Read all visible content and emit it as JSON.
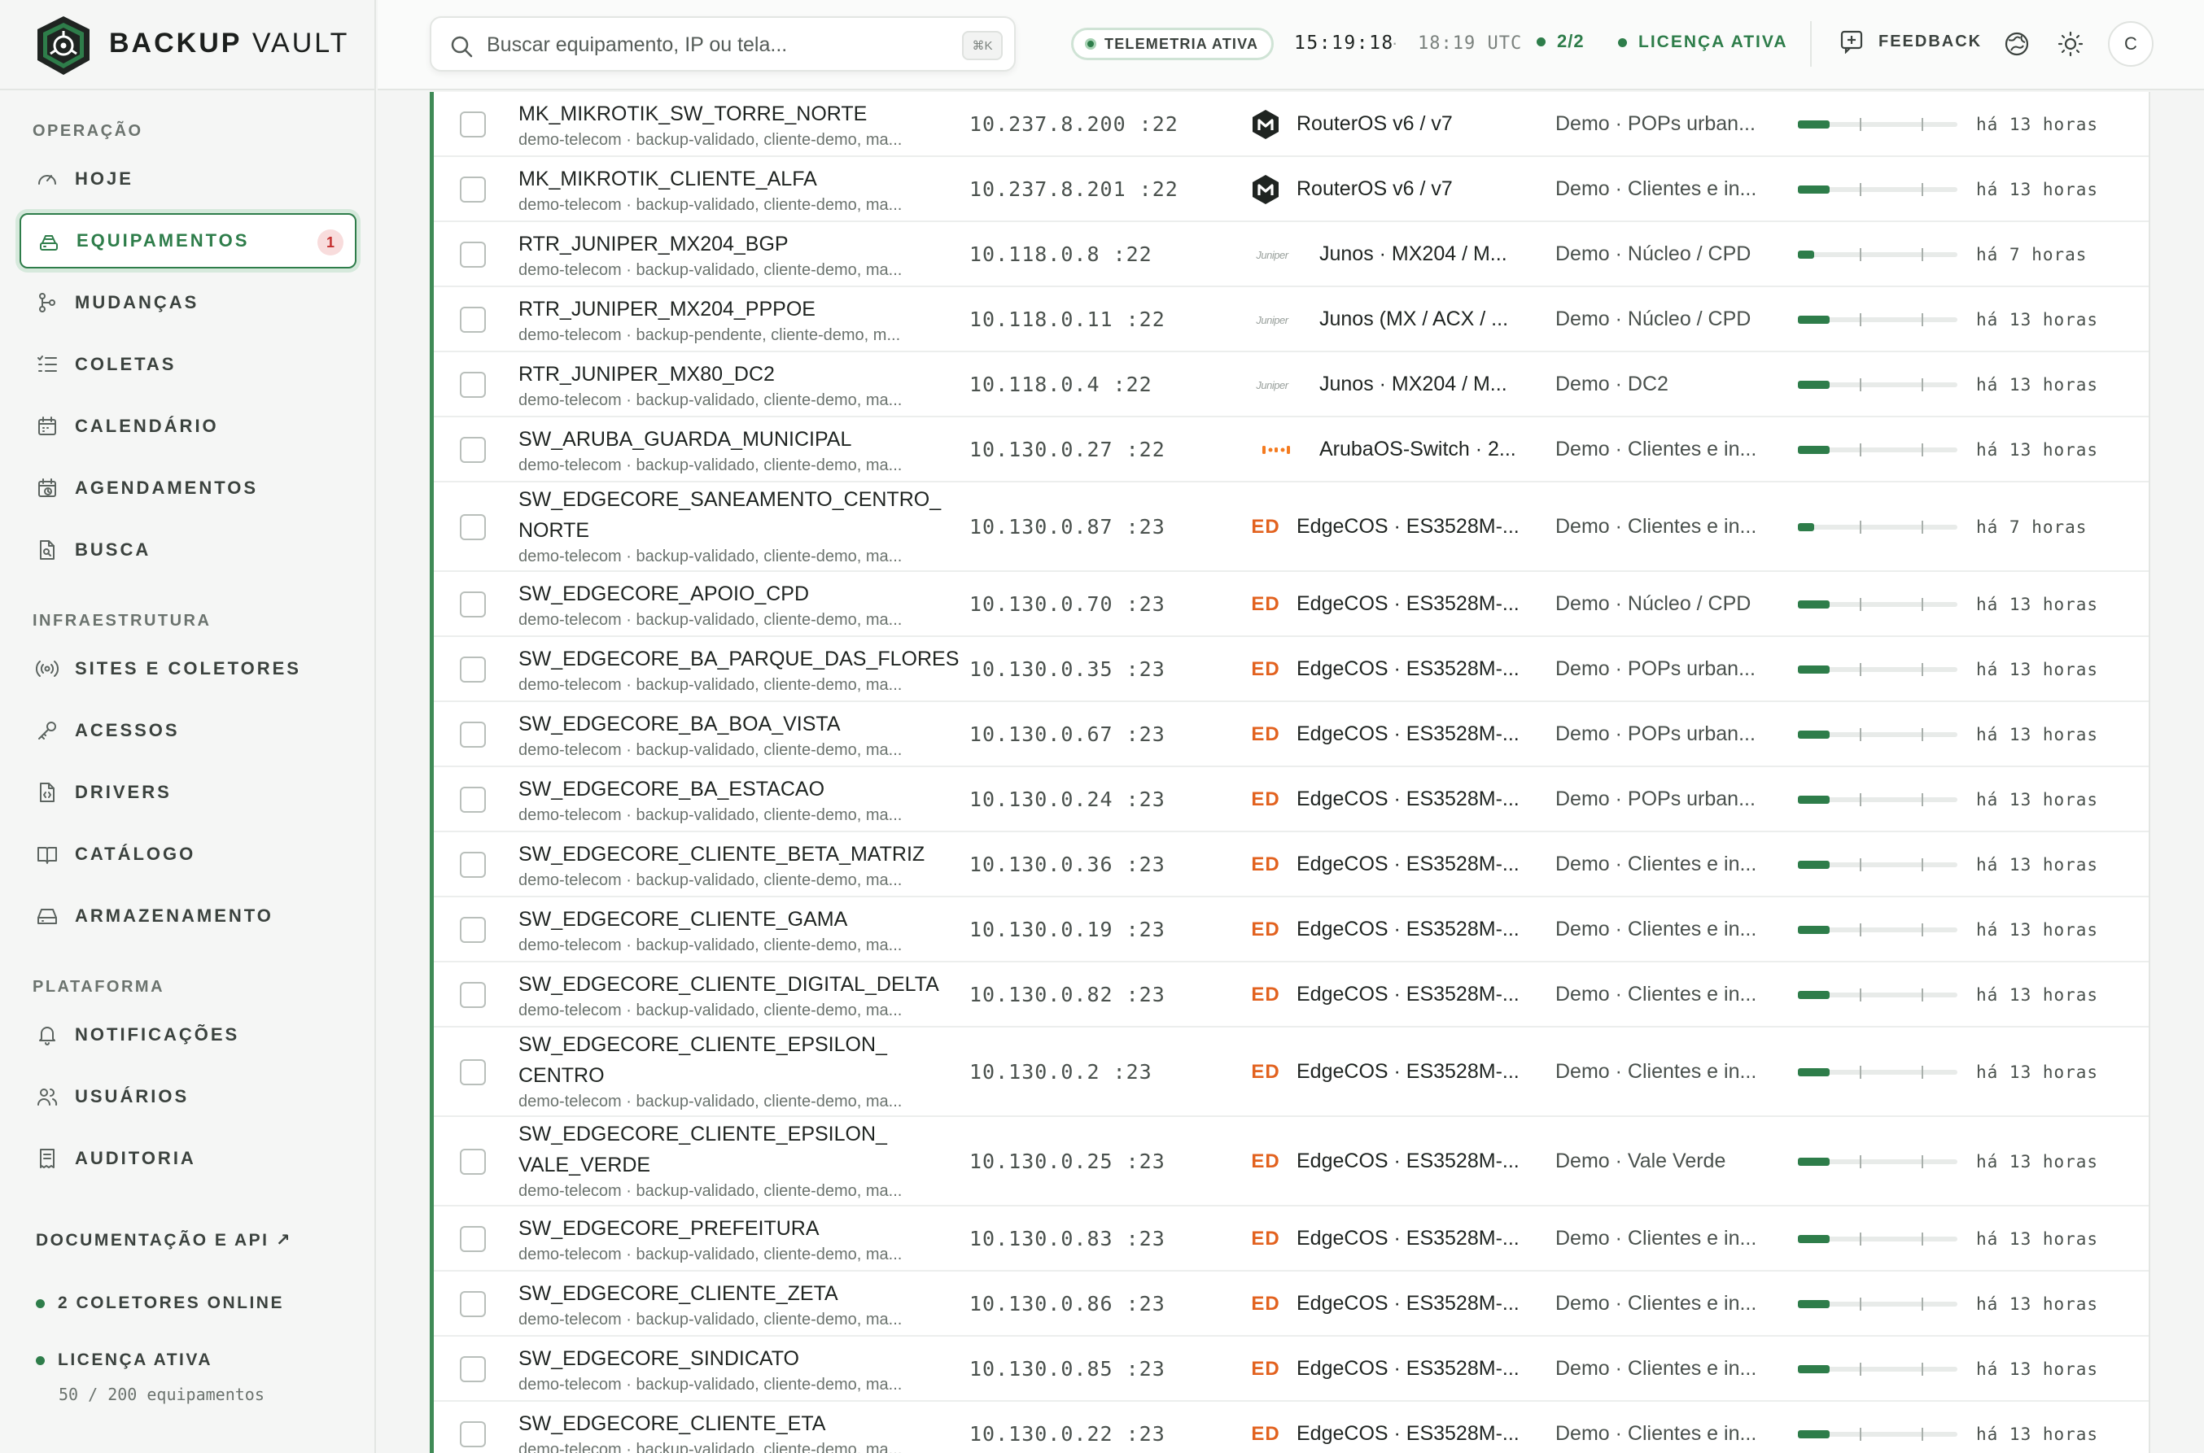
{
  "brand": {
    "name_bold": "BACKUP",
    "name_light": "VAULT",
    "logo_icon": "shield-hexagon-logo"
  },
  "sidebar": {
    "sections": [
      {
        "label": "OPERAÇÃO"
      },
      {
        "label": "INFRAESTRUTURA"
      },
      {
        "label": "PLATAFORMA"
      }
    ],
    "items": [
      {
        "label": "HOJE",
        "icon": "gauge-icon"
      },
      {
        "label": "EQUIPAMENTOS",
        "icon": "server-icon",
        "badge": "1",
        "active": true
      },
      {
        "label": "MUDANÇAS",
        "icon": "git-branch-icon"
      },
      {
        "label": "COLETAS",
        "icon": "list-check-icon"
      },
      {
        "label": "CALENDÁRIO",
        "icon": "calendar-icon"
      },
      {
        "label": "AGENDAMENTOS",
        "icon": "calendar-clock-icon"
      },
      {
        "label": "BUSCA",
        "icon": "file-search-icon"
      },
      {
        "label": "SITES E COLETORES",
        "icon": "radio-icon"
      },
      {
        "label": "ACESSOS",
        "icon": "key-icon"
      },
      {
        "label": "DRIVERS",
        "icon": "file-code-icon"
      },
      {
        "label": "CATÁLOGO",
        "icon": "book-open-icon"
      },
      {
        "label": "ARMAZENAMENTO",
        "icon": "hard-drive-icon"
      },
      {
        "label": "NOTIFICAÇÕES",
        "icon": "bell-icon"
      },
      {
        "label": "USUÁRIOS",
        "icon": "users-icon"
      },
      {
        "label": "AUDITORIA",
        "icon": "receipt-icon"
      }
    ],
    "docs_link": "DOCUMENTAÇÃO E API ↗",
    "collectors_status": "2 COLETORES ONLINE",
    "license_status": "LICENÇA ATIVA",
    "license_usage": "50 / 200 equipamentos"
  },
  "header": {
    "search_placeholder": "Buscar equipamento, IP ou tela...",
    "search_shortcut": "⌘K",
    "telemetry": "TELEMETRIA ATIVA",
    "time_local": "15:19:18",
    "time_sep": "·",
    "time_utc": "18:19 UTC",
    "collectors": "2/2",
    "license": "LICENÇA ATIVA",
    "feedback": "FEEDBACK",
    "avatar_initial": "C"
  },
  "colors": {
    "accent": "#2e7d4a",
    "ed_orange": "#e2621f",
    "badge_red": "#c42e2e"
  },
  "devices": [
    {
      "name": "MK_MIKROTIK_SW_TORRE_NORTE",
      "tags": "demo-telecom · backup-validado, cliente-demo, ma...",
      "ip": "10.237.8.200 :22",
      "vendor_icon": "mikrotik-icon",
      "vendor": "RouterOS v6 / v7",
      "site": "Demo · POPs urban...",
      "bar": 0.2,
      "age": "há 13 horas"
    },
    {
      "name": "MK_MIKROTIK_CLIENTE_ALFA",
      "tags": "demo-telecom · backup-validado, cliente-demo, ma...",
      "ip": "10.237.8.201 :22",
      "vendor_icon": "mikrotik-icon",
      "vendor": "RouterOS v6 / v7",
      "site": "Demo · Clientes e in...",
      "bar": 0.2,
      "age": "há 13 horas"
    },
    {
      "name": "RTR_JUNIPER_MX204_BGP",
      "tags": "demo-telecom · backup-validado, cliente-demo, ma...",
      "ip": "10.118.0.8 :22",
      "vendor_icon": "juniper-icon",
      "vendor": "Junos · MX204 / M...",
      "site": "Demo · Núcleo / CPD",
      "bar": 0.1,
      "age": "há 7 horas"
    },
    {
      "name": "RTR_JUNIPER_MX204_PPPOE",
      "tags": "demo-telecom · backup-pendente, cliente-demo, m...",
      "ip": "10.118.0.11 :22",
      "vendor_icon": "juniper-icon",
      "vendor": "Junos (MX / ACX / ...",
      "site": "Demo · Núcleo / CPD",
      "bar": 0.2,
      "age": "há 13 horas"
    },
    {
      "name": "RTR_JUNIPER_MX80_DC2",
      "tags": "demo-telecom · backup-validado, cliente-demo, ma...",
      "ip": "10.118.0.4 :22",
      "vendor_icon": "juniper-icon",
      "vendor": "Junos · MX204 / M...",
      "site": "Demo · DC2",
      "bar": 0.2,
      "age": "há 13 horas"
    },
    {
      "name": "SW_ARUBA_GUARDA_MUNICIPAL",
      "tags": "demo-telecom · backup-validado, cliente-demo, ma...",
      "ip": "10.130.0.27 :22",
      "vendor_icon": "aruba-icon",
      "vendor": "ArubaOS-Switch · 2...",
      "site": "Demo · Clientes e in...",
      "bar": 0.2,
      "age": "há 13 horas"
    },
    {
      "name": "SW_EDGECORE_SANEAMENTO_CENTRO_ NORTE",
      "tags": "demo-telecom · backup-validado, cliente-demo, ma...",
      "ip": "10.130.0.87 :23",
      "vendor_icon": "ED",
      "vendor": "EdgeCOS · ES3528M-...",
      "site": "Demo · Clientes e in...",
      "bar": 0.1,
      "age": "há 7 horas"
    },
    {
      "name": "SW_EDGECORE_APOIO_CPD",
      "tags": "demo-telecom · backup-validado, cliente-demo, ma...",
      "ip": "10.130.0.70 :23",
      "vendor_icon": "ED",
      "vendor": "EdgeCOS · ES3528M-...",
      "site": "Demo · Núcleo / CPD",
      "bar": 0.2,
      "age": "há 13 horas"
    },
    {
      "name": "SW_EDGECORE_BA_PARQUE_DAS_FLORES",
      "tags": "demo-telecom · backup-validado, cliente-demo, ma...",
      "ip": "10.130.0.35 :23",
      "vendor_icon": "ED",
      "vendor": "EdgeCOS · ES3528M-...",
      "site": "Demo · POPs urban...",
      "bar": 0.2,
      "age": "há 13 horas"
    },
    {
      "name": "SW_EDGECORE_BA_BOA_VISTA",
      "tags": "demo-telecom · backup-validado, cliente-demo, ma...",
      "ip": "10.130.0.67 :23",
      "vendor_icon": "ED",
      "vendor": "EdgeCOS · ES3528M-...",
      "site": "Demo · POPs urban...",
      "bar": 0.2,
      "age": "há 13 horas"
    },
    {
      "name": "SW_EDGECORE_BA_ESTACAO",
      "tags": "demo-telecom · backup-validado, cliente-demo, ma...",
      "ip": "10.130.0.24 :23",
      "vendor_icon": "ED",
      "vendor": "EdgeCOS · ES3528M-...",
      "site": "Demo · POPs urban...",
      "bar": 0.2,
      "age": "há 13 horas"
    },
    {
      "name": "SW_EDGECORE_CLIENTE_BETA_MATRIZ",
      "tags": "demo-telecom · backup-validado, cliente-demo, ma...",
      "ip": "10.130.0.36 :23",
      "vendor_icon": "ED",
      "vendor": "EdgeCOS · ES3528M-...",
      "site": "Demo · Clientes e in...",
      "bar": 0.2,
      "age": "há 13 horas"
    },
    {
      "name": "SW_EDGECORE_CLIENTE_GAMA",
      "tags": "demo-telecom · backup-validado, cliente-demo, ma...",
      "ip": "10.130.0.19 :23",
      "vendor_icon": "ED",
      "vendor": "EdgeCOS · ES3528M-...",
      "site": "Demo · Clientes e in...",
      "bar": 0.2,
      "age": "há 13 horas"
    },
    {
      "name": "SW_EDGECORE_CLIENTE_DIGITAL_DELTA",
      "tags": "demo-telecom · backup-validado, cliente-demo, ma...",
      "ip": "10.130.0.82 :23",
      "vendor_icon": "ED",
      "vendor": "EdgeCOS · ES3528M-...",
      "site": "Demo · Clientes e in...",
      "bar": 0.2,
      "age": "há 13 horas"
    },
    {
      "name": "SW_EDGECORE_CLIENTE_EPSILON_ CENTRO",
      "tags": "demo-telecom · backup-validado, cliente-demo, ma...",
      "ip": "10.130.0.2 :23",
      "vendor_icon": "ED",
      "vendor": "EdgeCOS · ES3528M-...",
      "site": "Demo · Clientes e in...",
      "bar": 0.2,
      "age": "há 13 horas"
    },
    {
      "name": "SW_EDGECORE_CLIENTE_EPSILON_ VALE_VERDE",
      "tags": "demo-telecom · backup-validado, cliente-demo, ma...",
      "ip": "10.130.0.25 :23",
      "vendor_icon": "ED",
      "vendor": "EdgeCOS · ES3528M-...",
      "site": "Demo · Vale Verde",
      "bar": 0.2,
      "age": "há 13 horas"
    },
    {
      "name": "SW_EDGECORE_PREFEITURA",
      "tags": "demo-telecom · backup-validado, cliente-demo, ma...",
      "ip": "10.130.0.83 :23",
      "vendor_icon": "ED",
      "vendor": "EdgeCOS · ES3528M-...",
      "site": "Demo · Clientes e in...",
      "bar": 0.2,
      "age": "há 13 horas"
    },
    {
      "name": "SW_EDGECORE_CLIENTE_ZETA",
      "tags": "demo-telecom · backup-validado, cliente-demo, ma...",
      "ip": "10.130.0.86 :23",
      "vendor_icon": "ED",
      "vendor": "EdgeCOS · ES3528M-...",
      "site": "Demo · Clientes e in...",
      "bar": 0.2,
      "age": "há 13 horas"
    },
    {
      "name": "SW_EDGECORE_SINDICATO",
      "tags": "demo-telecom · backup-validado, cliente-demo, ma...",
      "ip": "10.130.0.85 :23",
      "vendor_icon": "ED",
      "vendor": "EdgeCOS · ES3528M-...",
      "site": "Demo · Clientes e in...",
      "bar": 0.2,
      "age": "há 13 horas"
    },
    {
      "name": "SW_EDGECORE_CLIENTE_ETA",
      "tags": "demo-telecom · backup-validado, cliente-demo, ma...",
      "ip": "10.130.0.22 :23",
      "vendor_icon": "ED",
      "vendor": "EdgeCOS · ES3528M-...",
      "site": "Demo · Clientes e in...",
      "bar": 0.2,
      "age": "há 13 horas"
    }
  ]
}
